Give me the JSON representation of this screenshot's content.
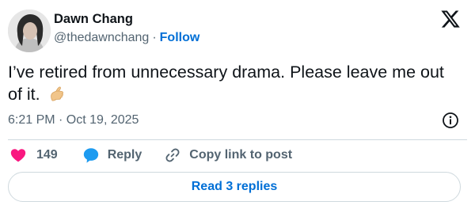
{
  "user": {
    "display_name": "Dawn Chang",
    "handle": "@thedawnchang",
    "separator": "·",
    "follow_label": "Follow"
  },
  "tweet": {
    "text": "I’ve retired from unnecessary drama. Please leave me out of it.",
    "emoji_name": "hand-with-index-finger-and-thumb-crossed-icon",
    "timestamp": "6:21 PM · Oct 19, 2025"
  },
  "actions": {
    "like_count": "149",
    "reply_label": "Reply",
    "copy_label": "Copy link to post"
  },
  "footer": {
    "read_replies_label": "Read 3 replies"
  },
  "colors": {
    "like": "#f91880",
    "reply": "#1d9bf0",
    "link": "#006fd6",
    "muted": "#536471",
    "border": "#cfd9de"
  }
}
